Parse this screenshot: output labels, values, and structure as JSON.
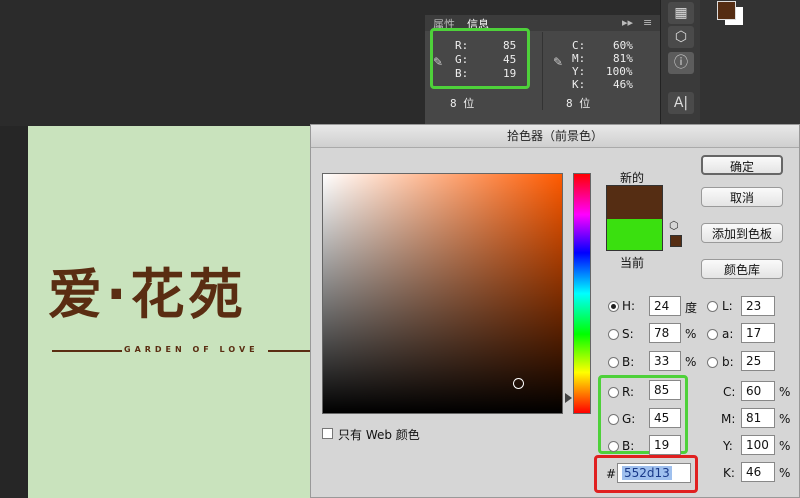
{
  "info_panel": {
    "tabs": [
      "属性",
      "信息"
    ],
    "rgb": [
      {
        "k": "R:",
        "v": "85"
      },
      {
        "k": "G:",
        "v": "45"
      },
      {
        "k": "B:",
        "v": "19"
      }
    ],
    "cmyk": [
      {
        "k": "C:",
        "v": "60%"
      },
      {
        "k": "M:",
        "v": "81%"
      },
      {
        "k": "Y:",
        "v": "100%"
      },
      {
        "k": "K:",
        "v": "46%"
      }
    ],
    "bitdepth_left": "8 位",
    "bitdepth_right": "8 位"
  },
  "canvas": {
    "logo_text": "爱·花苑",
    "logo_sub": "GARDEN OF LOVE"
  },
  "dialog": {
    "title": "拾色器（前景色）",
    "new_label": "新的",
    "current_label": "当前",
    "buttons": {
      "ok": "确定",
      "cancel": "取消",
      "add_swatch": "添加到色板",
      "libraries": "颜色库"
    },
    "web_only": "只有 Web 颜色",
    "hsb": [
      {
        "k": "H:",
        "v": "24",
        "u": "度"
      },
      {
        "k": "S:",
        "v": "78",
        "u": "%"
      },
      {
        "k": "B:",
        "v": "33",
        "u": "%"
      }
    ],
    "lab": [
      {
        "k": "L:",
        "v": "23"
      },
      {
        "k": "a:",
        "v": "17"
      },
      {
        "k": "b:",
        "v": "25"
      }
    ],
    "rgb": [
      {
        "k": "R:",
        "v": "85"
      },
      {
        "k": "G:",
        "v": "45"
      },
      {
        "k": "B:",
        "v": "19"
      }
    ],
    "cmyk": [
      {
        "k": "C:",
        "v": "60",
        "u": "%"
      },
      {
        "k": "M:",
        "v": "81",
        "u": "%"
      },
      {
        "k": "Y:",
        "v": "100",
        "u": "%"
      },
      {
        "k": "K:",
        "v": "46",
        "u": "%"
      }
    ],
    "hex_prefix": "#",
    "hex": "552d13"
  },
  "colors": {
    "new": "#552d13",
    "current": "#3ae00f",
    "highlight_green": "#4ed13a",
    "highlight_red": "#e02020"
  }
}
